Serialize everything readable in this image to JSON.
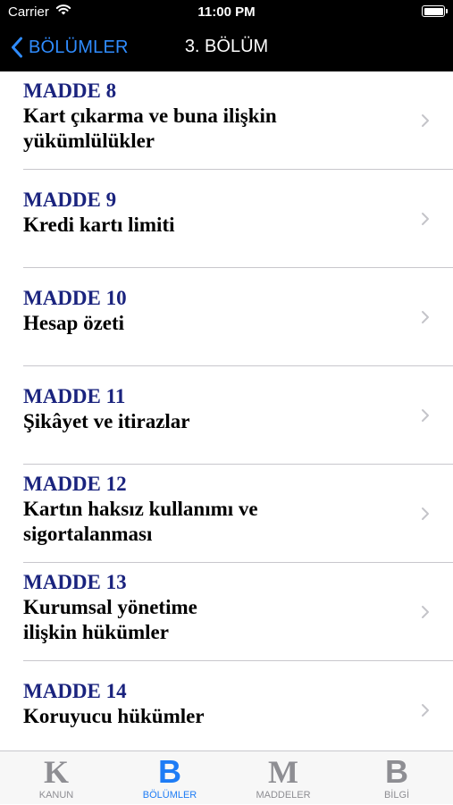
{
  "status_bar": {
    "carrier": "Carrier",
    "time": "11:00 PM"
  },
  "nav": {
    "back_label": "BÖLÜMLER",
    "title": "3. BÖLÜM"
  },
  "items": [
    {
      "code": "MADDE 8",
      "line1": "Kart çıkarma ve buna ilişkin",
      "line2": "yükümlülükler"
    },
    {
      "code": "MADDE 9",
      "line1": "Kredi kartı limiti",
      "line2": ""
    },
    {
      "code": "MADDE 10",
      "line1": "Hesap özeti",
      "line2": ""
    },
    {
      "code": "MADDE 11",
      "line1": "Şikâyet ve itirazlar",
      "line2": ""
    },
    {
      "code": "MADDE 12",
      "line1": "Kartın haksız kullanımı ve",
      "line2": "sigortalanması"
    },
    {
      "code": "MADDE 13",
      "line1": "Kurumsal yönetime",
      "line2": "ilişkin hükümler"
    },
    {
      "code": "MADDE 14",
      "line1": "Koruyucu hükümler",
      "line2": ""
    }
  ],
  "tabs": [
    {
      "glyph": "K",
      "label": "KANUN",
      "selected": false
    },
    {
      "glyph": "B",
      "label": "BÖLÜMLER",
      "selected": true
    },
    {
      "glyph": "M",
      "label": "MADDELER",
      "selected": false
    },
    {
      "glyph": "B",
      "label": "BİLGİ",
      "selected": false
    }
  ],
  "colors": {
    "accent": "#1e7cf5",
    "article_code": "#1a237e",
    "inactive_tab": "#8e8e93",
    "chevron": "#c4c4c9"
  },
  "icons": {
    "back": "chevron-left-icon",
    "row": "chevron-right-icon",
    "wifi": "wifi-icon",
    "battery": "battery-icon"
  }
}
